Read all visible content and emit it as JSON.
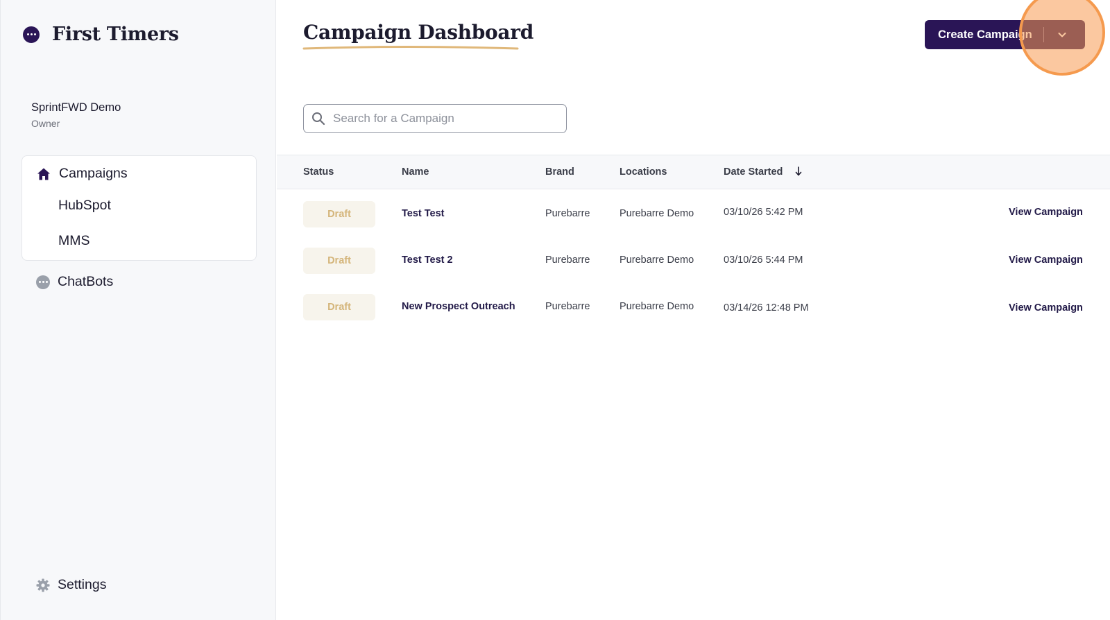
{
  "app": {
    "name": "First Timers"
  },
  "account": {
    "name": "SprintFWD Demo",
    "role": "Owner"
  },
  "sidebar": {
    "campaigns_label": "Campaigns",
    "sub_items": [
      "HubSpot",
      "MMS"
    ],
    "chatbots_label": "ChatBots",
    "settings_label": "Settings"
  },
  "header": {
    "title": "Campaign Dashboard",
    "create_label": "Create Campaign"
  },
  "search": {
    "placeholder": "Search for a Campaign",
    "value": ""
  },
  "table": {
    "columns": [
      "Status",
      "Name",
      "Brand",
      "Locations",
      "Date Started"
    ],
    "sort_column": "Date Started",
    "rows": [
      {
        "status": "Draft",
        "name": "Test Test",
        "brand": "Purebarre",
        "location": "Purebarre Demo",
        "date": "03/10/26 5:42 PM",
        "action": "View Campaign"
      },
      {
        "status": "Draft",
        "name": "Test Test 2",
        "brand": "Purebarre",
        "location": "Purebarre Demo",
        "date": "03/10/26 5:44 PM",
        "action": "View Campaign"
      },
      {
        "status": "Draft",
        "name": "New Prospect Outreach",
        "brand": "Purebarre",
        "location": "Purebarre Demo",
        "date": "03/14/26 12:48 PM",
        "action": "View Campaign"
      }
    ]
  },
  "colors": {
    "primary": "#2a1556",
    "draft_badge_bg": "#f7f4ec",
    "draft_badge_text": "#d4b57a",
    "title_underline": "#e0b87a",
    "highlight": "#f59a4e"
  },
  "icons": [
    "chat-bubble-icon",
    "home-icon",
    "gear-icon",
    "search-icon",
    "chevron-down-icon",
    "sort-arrow-down-icon"
  ]
}
